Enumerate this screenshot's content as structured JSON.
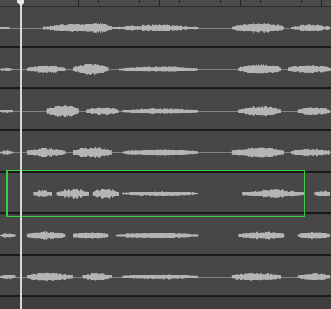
{
  "editor": {
    "track_count": 7,
    "selected_track": 5,
    "colors": {
      "background": "#3e3e3e",
      "track": "#474747",
      "separator": "#1a1a1a",
      "waveform": "#b4b4b4",
      "playhead": "#d8d8d8",
      "selection": "#35d13c"
    }
  },
  "tracks": [
    {
      "id": 1,
      "clips": [
        [
          0.0,
          0.03,
          0.2
        ],
        [
          0.13,
          0.33,
          0.6
        ],
        [
          0.25,
          0.34,
          0.75
        ],
        [
          0.34,
          0.6,
          0.45
        ],
        [
          0.7,
          0.86,
          0.7
        ],
        [
          0.88,
          1.0,
          0.5
        ]
      ]
    },
    {
      "id": 2,
      "clips": [
        [
          0.0,
          0.04,
          0.25
        ],
        [
          0.08,
          0.2,
          0.55
        ],
        [
          0.22,
          0.33,
          0.8
        ],
        [
          0.36,
          0.6,
          0.4
        ],
        [
          0.72,
          0.85,
          0.7
        ],
        [
          0.87,
          1.0,
          0.6
        ]
      ]
    },
    {
      "id": 3,
      "clips": [
        [
          0.0,
          0.04,
          0.2
        ],
        [
          0.14,
          0.24,
          0.9
        ],
        [
          0.26,
          0.36,
          0.55
        ],
        [
          0.37,
          0.6,
          0.4
        ],
        [
          0.72,
          0.85,
          0.7
        ],
        [
          0.9,
          1.0,
          0.6
        ]
      ]
    },
    {
      "id": 4,
      "clips": [
        [
          0.0,
          0.04,
          0.3
        ],
        [
          0.08,
          0.2,
          0.65
        ],
        [
          0.22,
          0.34,
          0.8
        ],
        [
          0.37,
          0.6,
          0.45
        ],
        [
          0.7,
          0.86,
          0.75
        ],
        [
          0.88,
          1.0,
          0.55
        ]
      ]
    },
    {
      "id": 5,
      "clips": [
        [
          0.1,
          0.16,
          0.5
        ],
        [
          0.17,
          0.27,
          0.7
        ],
        [
          0.28,
          0.36,
          0.75
        ],
        [
          0.37,
          0.6,
          0.35
        ],
        [
          0.73,
          0.92,
          0.55
        ],
        [
          0.95,
          1.0,
          0.5
        ]
      ]
    },
    {
      "id": 6,
      "clips": [
        [
          0.0,
          0.05,
          0.3
        ],
        [
          0.08,
          0.2,
          0.6
        ],
        [
          0.22,
          0.33,
          0.5
        ],
        [
          0.35,
          0.6,
          0.4
        ],
        [
          0.72,
          0.86,
          0.55
        ],
        [
          0.9,
          1.0,
          0.5
        ]
      ]
    },
    {
      "id": 7,
      "clips": [
        [
          0.0,
          0.05,
          0.3
        ],
        [
          0.08,
          0.22,
          0.6
        ],
        [
          0.25,
          0.34,
          0.55
        ],
        [
          0.37,
          0.6,
          0.35
        ],
        [
          0.7,
          0.85,
          0.6
        ],
        [
          0.9,
          1.0,
          0.5
        ]
      ]
    }
  ]
}
